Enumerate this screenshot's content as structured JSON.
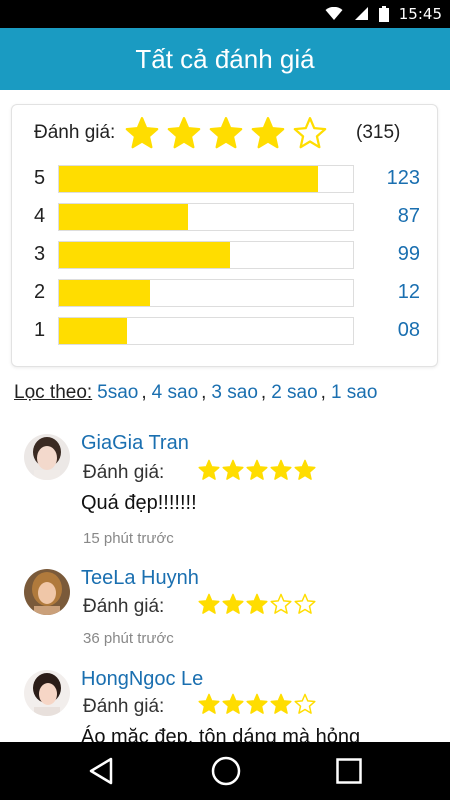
{
  "status_bar": {
    "time": "15:45"
  },
  "app_bar": {
    "title": "Tất cả đánh giá"
  },
  "summary": {
    "label": "Đánh giá:",
    "average_stars": 4,
    "max_stars": 5,
    "total": "(315)",
    "bars": [
      {
        "label": "5",
        "value": "123",
        "fill_fraction": 0.88
      },
      {
        "label": "4",
        "value": "87",
        "fill_fraction": 0.44
      },
      {
        "label": "3",
        "value": "99",
        "fill_fraction": 0.58
      },
      {
        "label": "2",
        "value": "12",
        "fill_fraction": 0.31
      },
      {
        "label": "1",
        "value": "08",
        "fill_fraction": 0.23
      }
    ]
  },
  "filter": {
    "label": "Lọc theo:",
    "options": [
      "5sao",
      "4 sao",
      "3 sao",
      "2 sao",
      "1 sao"
    ]
  },
  "reviews": [
    {
      "name": "GiaGia Tran",
      "rating_label": "Đánh giá:",
      "stars": 5,
      "comment": "Quá đẹp!!!!!!!",
      "time": "15 phút trước"
    },
    {
      "name": "TeeLa Huynh",
      "rating_label": "Đánh giá:",
      "stars": 3,
      "comment": "",
      "time": "36 phút trước"
    },
    {
      "name": "HongNgoc Le",
      "rating_label": "Đánh giá:",
      "stars": 4,
      "comment": "Áo mặc đẹp, tôn dáng mà hỏng",
      "time": ""
    }
  ],
  "colors": {
    "accent": "#1a9bc2",
    "star": "#ffdd00",
    "link": "#1a6fb0"
  }
}
